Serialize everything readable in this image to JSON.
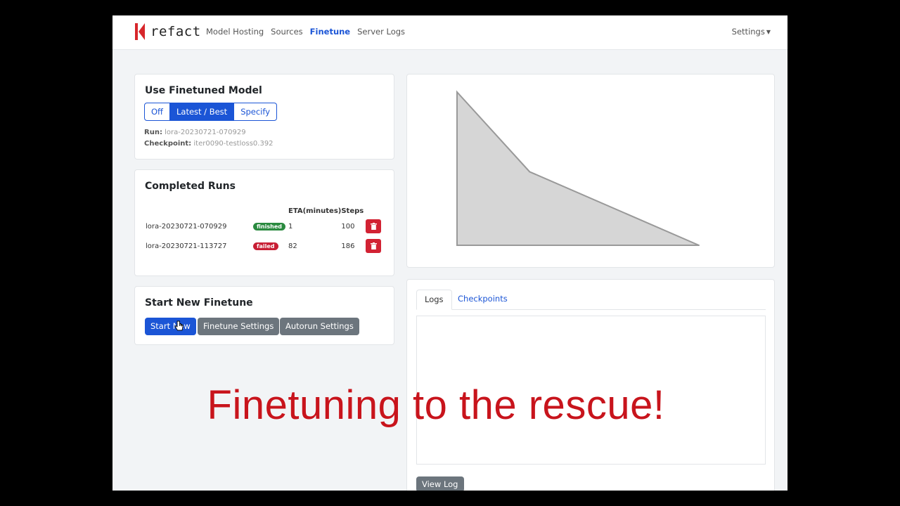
{
  "navbar": {
    "logo_text": "refact",
    "links": [
      "Model Hosting",
      "Sources",
      "Finetune",
      "Server Logs"
    ],
    "active_index": 2,
    "settings_label": "Settings"
  },
  "use_model": {
    "title": "Use Finetuned Model",
    "options": [
      "Off",
      "Latest / Best",
      "Specify"
    ],
    "selected": "Latest / Best",
    "run_label": "Run:",
    "run_value": "lora-20230721-070929",
    "checkpoint_label": "Checkpoint:",
    "checkpoint_value": "iter0090-testloss0.392"
  },
  "completed_runs": {
    "title": "Completed Runs",
    "headers": [
      "",
      "",
      "ETA(minutes)",
      "Steps",
      ""
    ],
    "rows": [
      {
        "name": "lora-20230721-070929",
        "status": "finished",
        "eta": "1",
        "steps": "100"
      },
      {
        "name": "lora-20230721-113727",
        "status": "failed",
        "eta": "82",
        "steps": "186"
      }
    ]
  },
  "start_new": {
    "title": "Start New Finetune",
    "start_label": "Start New",
    "settings_label": "Finetune Settings",
    "autorun_label": "Autorun Settings"
  },
  "chart_data": {
    "type": "area",
    "x": [
      0,
      0.3,
      1
    ],
    "values": [
      1,
      0.48,
      0
    ],
    "title": "",
    "xlabel": "",
    "ylabel": "",
    "fill_color": "#d6d6d6",
    "line_color": "#999999"
  },
  "logs": {
    "tabs": [
      "Logs",
      "Checkpoints"
    ],
    "active_tab": "Logs",
    "view_log_label": "View Log"
  },
  "caption": "Finetuning to the rescue!",
  "colors": {
    "primary": "#1b55d6",
    "danger": "#d22233",
    "success": "#2a8a3f"
  }
}
